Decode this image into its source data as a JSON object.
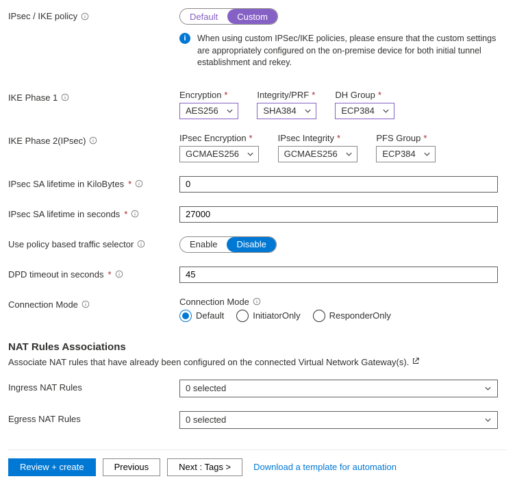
{
  "ipsecPolicy": {
    "label": "IPsec / IKE policy",
    "optDefault": "Default",
    "optCustom": "Custom",
    "infoText": "When using custom IPSec/IKE policies, please ensure that the custom settings are appropriately configured on the on-premise device for both initial tunnel establishment and rekey."
  },
  "phase1": {
    "label": "IKE Phase 1",
    "encryption": {
      "label": "Encryption",
      "value": "AES256"
    },
    "integrity": {
      "label": "Integrity/PRF",
      "value": "SHA384"
    },
    "dhGroup": {
      "label": "DH Group",
      "value": "ECP384"
    }
  },
  "phase2": {
    "label": "IKE Phase 2(IPsec)",
    "encryption": {
      "label": "IPsec Encryption",
      "value": "GCMAES256"
    },
    "integrity": {
      "label": "IPsec Integrity",
      "value": "GCMAES256"
    },
    "pfsGroup": {
      "label": "PFS Group",
      "value": "ECP384"
    }
  },
  "saKb": {
    "label": "IPsec SA lifetime in KiloBytes",
    "value": "0"
  },
  "saSec": {
    "label": "IPsec SA lifetime in seconds",
    "value": "27000"
  },
  "trafficSelector": {
    "label": "Use policy based traffic selector",
    "enable": "Enable",
    "disable": "Disable"
  },
  "dpd": {
    "label": "DPD timeout in seconds",
    "value": "45"
  },
  "connMode": {
    "label": "Connection Mode",
    "groupLabel": "Connection Mode",
    "optDefault": "Default",
    "optInitiator": "InitiatorOnly",
    "optResponder": "ResponderOnly"
  },
  "nat": {
    "heading": "NAT Rules Associations",
    "subtext": "Associate NAT rules that have already been configured on the connected Virtual Network Gateway(s).",
    "ingressLabel": "Ingress NAT Rules",
    "ingressValue": "0 selected",
    "egressLabel": "Egress NAT Rules",
    "egressValue": "0 selected"
  },
  "footer": {
    "review": "Review + create",
    "previous": "Previous",
    "next": "Next : Tags >",
    "template": "Download a template for automation"
  }
}
